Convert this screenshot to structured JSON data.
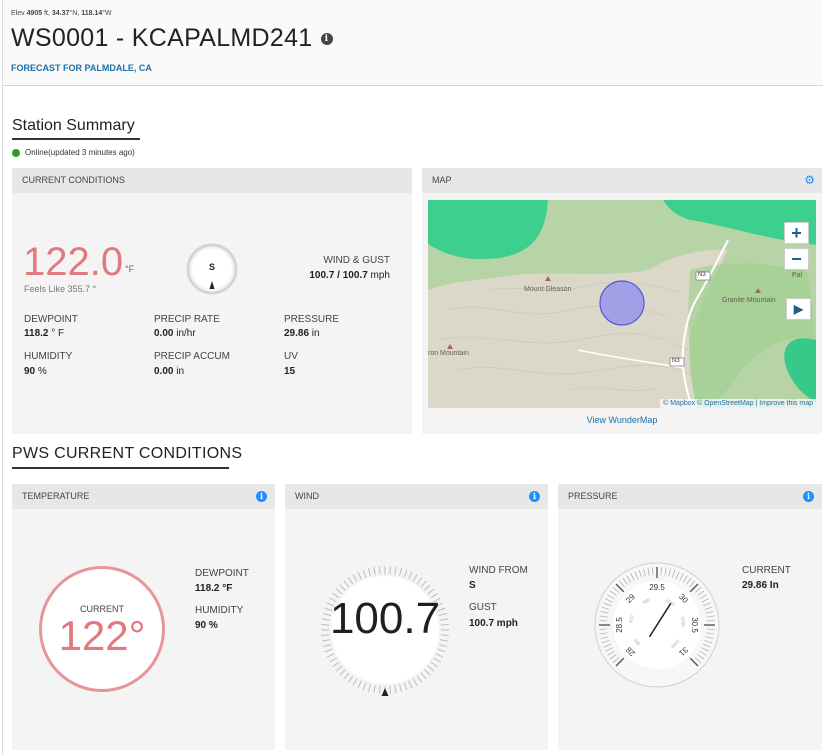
{
  "header": {
    "elev_label": "Elev",
    "elev_value": "4905",
    "elev_unit": "ft,",
    "lat": "34.37",
    "lat_unit": "°N,",
    "lon": "118.14",
    "lon_unit": "°W",
    "title": "WS0001 - KCAPALMD241",
    "info_glyph": "i",
    "forecast_link": "FORECAST FOR PALMDALE, CA"
  },
  "summary": {
    "title": "Station Summary",
    "status": "Online(updated 3 minutes ago)",
    "status_color": "#2a9d2a"
  },
  "current_conditions": {
    "heading": "CURRENT CONDITIONS",
    "temperature": "122.0",
    "temp_unit": "°F",
    "feels_like": "Feels Like 355.7 °",
    "wind_dir": "S",
    "wind_gust_label": "WIND & GUST",
    "wind_value": "100.7",
    "wind_sep": " / ",
    "gust_value": "100.7",
    "wind_unit": " mph",
    "dewpoint_label": "DEWPOINT",
    "dewpoint_value": "118.2",
    "dewpoint_unit": " ° F",
    "humidity_label": "HUMIDITY",
    "humidity_value": "90",
    "humidity_unit": " %",
    "precip_rate_label": "PRECIP RATE",
    "precip_rate_value": "0.00",
    "precip_rate_unit": " in/hr",
    "precip_accum_label": "PRECIP ACCUM",
    "precip_accum_value": "0.00",
    "precip_accum_unit": " in",
    "pressure_label": "PRESSURE",
    "pressure_value": "29.86",
    "pressure_unit": " in",
    "uv_label": "UV",
    "uv_value": "15",
    "temp_color": "#e07a7f"
  },
  "map": {
    "heading": "MAP",
    "gear_icon": "gear-icon",
    "zoom_in": "+",
    "zoom_out": "−",
    "play": "▶",
    "label_mount_gleason": "Mount Gleason",
    "label_granite_mountain": "Granite Mountain",
    "label_iron_mountain": "ron Mountain",
    "road_n3_a": "N3",
    "road_n3_b": "N3",
    "label_pal": "Pal",
    "attribution": "© Mapbox © OpenStreetMap | Improve this map",
    "view_link": "View WunderMap"
  },
  "pws": {
    "title": "PWS CURRENT CONDITIONS",
    "temperature": {
      "heading": "TEMPERATURE",
      "current_label": "CURRENT",
      "value": "122°",
      "dewpoint_label": "DEWPOINT",
      "dewpoint_value": "118.2 °F",
      "humidity_label": "HUMIDITY",
      "humidity_value": "90 %"
    },
    "wind": {
      "heading": "WIND",
      "value": "100.7",
      "wind_from_label": "WIND FROM",
      "wind_from_value": "S",
      "gust_label": "GUST",
      "gust_value": "100.7 mph"
    },
    "pressure": {
      "heading": "PRESSURE",
      "current_label": "CURRENT",
      "current_value": "29.86 In",
      "gauge_value": 29.86,
      "ticks": [
        "28",
        "28.5",
        "29",
        "29.5",
        "30",
        "30.5",
        "31"
      ],
      "mb_ticks": [
        "950",
        "970",
        "990",
        "1010",
        "1030",
        "1050"
      ]
    }
  }
}
